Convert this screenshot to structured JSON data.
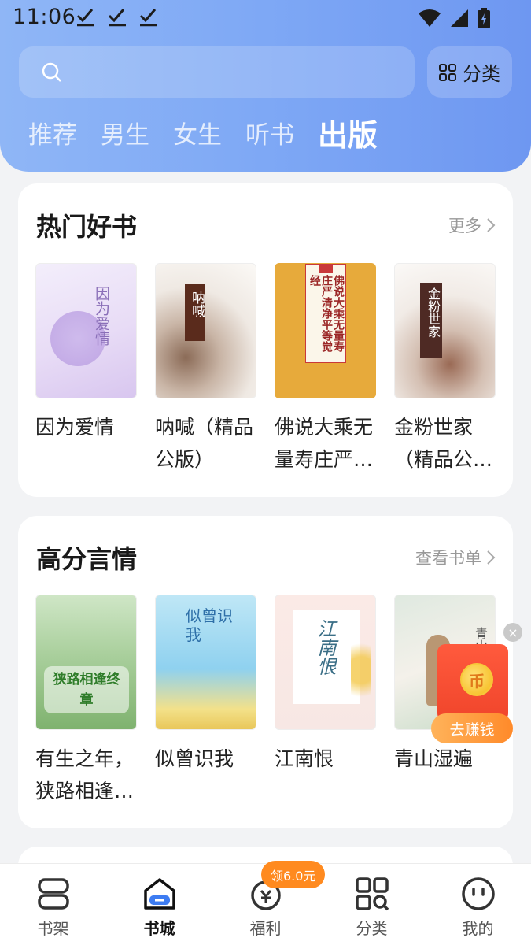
{
  "status_bar": {
    "time": "11:06"
  },
  "search": {
    "placeholder": "",
    "category_label": "分类"
  },
  "tabs": [
    {
      "label": "推荐",
      "active": false
    },
    {
      "label": "男生",
      "active": false
    },
    {
      "label": "女生",
      "active": false
    },
    {
      "label": "听书",
      "active": false
    },
    {
      "label": "出版",
      "active": true
    }
  ],
  "sections": [
    {
      "title": "热门好书",
      "more_label": "更多",
      "books": [
        {
          "title": "因为爱情",
          "cover_text": "因为爱情"
        },
        {
          "title": "呐喊（精品公版）",
          "cover_text": "呐喊"
        },
        {
          "title": "佛说大乘无量寿庄严清净平等觉经",
          "cover_text": "佛说大乘无量寿庄严清净平等觉经"
        },
        {
          "title": "金粉世家（精品公版）",
          "cover_text": "金粉世家"
        }
      ]
    },
    {
      "title": "高分言情",
      "more_label": "查看书单",
      "books": [
        {
          "title": "有生之年，狭路相逢终章",
          "cover_text": "狭路相逢终章"
        },
        {
          "title": "似曾识我",
          "cover_text": "似曾识我"
        },
        {
          "title": "江南恨",
          "cover_text": "江南恨"
        },
        {
          "title": "青山湿遍",
          "cover_text": "青山"
        }
      ]
    }
  ],
  "promo": {
    "button_label": "去赚钱",
    "close_symbol": "×"
  },
  "bottom_nav": {
    "badge": "领6.0元",
    "items": [
      {
        "label": "书架",
        "icon": "bookshelf-icon",
        "active": false
      },
      {
        "label": "书城",
        "icon": "bookstore-icon",
        "active": true
      },
      {
        "label": "福利",
        "icon": "welfare-icon",
        "active": false
      },
      {
        "label": "分类",
        "icon": "category-icon",
        "active": false
      },
      {
        "label": "我的",
        "icon": "profile-icon",
        "active": false
      }
    ]
  },
  "colors": {
    "accent": "#6e97f1",
    "promo_red": "#f0452b",
    "badge_orange": "#ff8a1f"
  }
}
